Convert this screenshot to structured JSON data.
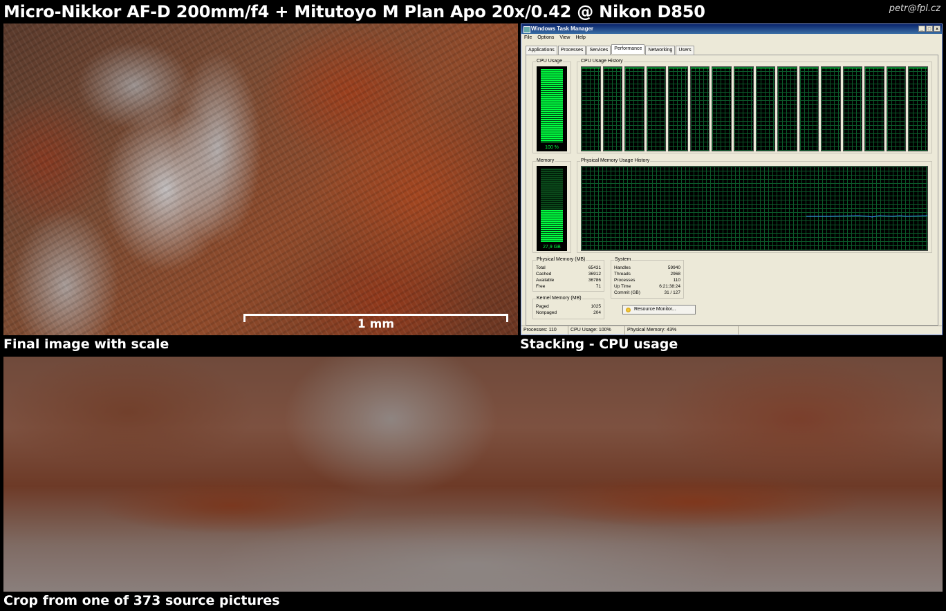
{
  "header": {
    "title": "Micro-Nikkor AF-D 200mm/f4 + Mitutoyo M Plan Apo 20x/0.42 @ Nikon D850",
    "credit": "petr@fpl.cz"
  },
  "panels": {
    "final_image": {
      "caption": "Final image with scale",
      "scale_label": "1 mm"
    },
    "stacking": {
      "caption": "Stacking - CPU usage"
    },
    "crop": {
      "caption": "Crop from one of 373 source pictures"
    }
  },
  "task_manager": {
    "title": "Windows Task Manager",
    "window_buttons": [
      "_",
      "□",
      "×"
    ],
    "menu": [
      "File",
      "Options",
      "View",
      "Help"
    ],
    "tabs": [
      {
        "label": "Applications",
        "active": false
      },
      {
        "label": "Processes",
        "active": false
      },
      {
        "label": "Services",
        "active": false
      },
      {
        "label": "Performance",
        "active": true
      },
      {
        "label": "Networking",
        "active": false
      },
      {
        "label": "Users",
        "active": false
      }
    ],
    "cpu_usage": {
      "label": "CPU Usage",
      "value_text": "100 %",
      "fraction": 1.0
    },
    "cpu_history": {
      "label": "CPU Usage History",
      "core_count": 16
    },
    "memory": {
      "label": "Memory",
      "value_text": "27,9 GB",
      "fraction": 0.43
    },
    "memory_history": {
      "label": "Physical Memory Usage History"
    },
    "physical_memory": {
      "label": "Physical Memory (MB)",
      "rows": [
        {
          "name": "Total",
          "value": "65431"
        },
        {
          "name": "Cached",
          "value": "36912"
        },
        {
          "name": "Available",
          "value": "36786"
        },
        {
          "name": "Free",
          "value": "71"
        }
      ]
    },
    "kernel_memory": {
      "label": "Kernel Memory (MB)",
      "rows": [
        {
          "name": "Paged",
          "value": "1025"
        },
        {
          "name": "Nonpaged",
          "value": "204"
        }
      ]
    },
    "system": {
      "label": "System",
      "rows": [
        {
          "name": "Handles",
          "value": "59940"
        },
        {
          "name": "Threads",
          "value": "2968"
        },
        {
          "name": "Processes",
          "value": "110"
        },
        {
          "name": "Up Time",
          "value": "6:21:38:24"
        },
        {
          "name": "Commit (GB)",
          "value": "31 / 127"
        }
      ]
    },
    "resource_monitor_label": "Resource Monitor...",
    "status": {
      "processes": "Processes: 110",
      "cpu": "CPU Usage: 100%",
      "memory": "Physical Memory: 43%"
    },
    "colors": {
      "graph_green": "#00ff40",
      "memory_line": "#3a8dff",
      "titlebar": "#0a246a"
    }
  }
}
